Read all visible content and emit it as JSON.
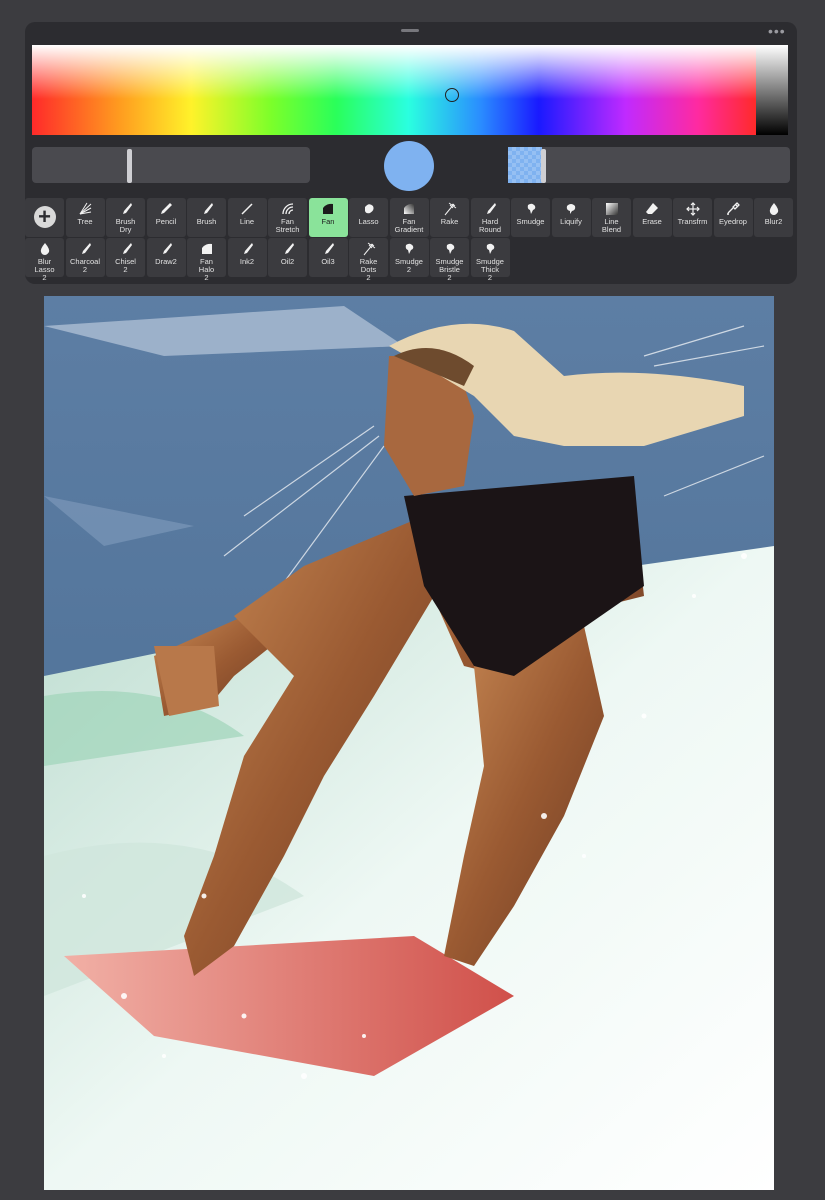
{
  "menu": {
    "more_glyph": "•••"
  },
  "color": {
    "current": "#7fb2f0",
    "spectrum_colors": [
      "#ff2a2a",
      "#ff9b1f",
      "#fff22a",
      "#2aff5a",
      "#2affe0",
      "#2a8cff",
      "#1a1aff",
      "#c02aff",
      "#ff2aa0"
    ],
    "opacity_fraction": 0.13
  },
  "tools": [
    {
      "label": "",
      "icon": "add-icon"
    },
    {
      "label": "Tree",
      "icon": "tree-brush-icon"
    },
    {
      "label": "Brush\nDry",
      "icon": "brush-icon"
    },
    {
      "label": "Pencil",
      "icon": "pencil-icon"
    },
    {
      "label": "Brush",
      "icon": "brush-icon"
    },
    {
      "label": "Line",
      "icon": "line-icon"
    },
    {
      "label": "Fan\nStretch",
      "icon": "fan-stretch-icon"
    },
    {
      "label": "Fan",
      "icon": "fan-icon",
      "active": true
    },
    {
      "label": "Lasso",
      "icon": "lasso-icon"
    },
    {
      "label": "Fan\nGradient",
      "icon": "fan-gradient-icon"
    },
    {
      "label": "Rake",
      "icon": "rake-icon"
    },
    {
      "label": "Hard\nRound",
      "icon": "brush-icon"
    },
    {
      "label": "Smudge",
      "icon": "smudge-icon"
    },
    {
      "label": "Liquify",
      "icon": "liquify-icon"
    },
    {
      "label": "Line\nBlend",
      "icon": "line-blend-icon"
    },
    {
      "label": "Erase",
      "icon": "eraser-icon"
    },
    {
      "label": "Transfrm",
      "icon": "transform-icon"
    },
    {
      "label": "Eyedrop",
      "icon": "eyedropper-icon"
    },
    {
      "label": "Blur2",
      "icon": "drop-icon"
    },
    {
      "label": "Blur\nLasso\n2",
      "icon": "drop-icon"
    },
    {
      "label": "Charcoal\n2",
      "icon": "brush-icon"
    },
    {
      "label": "Chisel\n2",
      "icon": "brush-icon"
    },
    {
      "label": "Draw2",
      "icon": "brush-icon"
    },
    {
      "label": "Fan\nHalo\n2",
      "icon": "fan-icon"
    },
    {
      "label": "Ink2",
      "icon": "brush-icon"
    },
    {
      "label": "Oil2",
      "icon": "brush-icon"
    },
    {
      "label": "Oil3",
      "icon": "brush-icon"
    },
    {
      "label": "Rake\nDots\n2",
      "icon": "rake-icon"
    },
    {
      "label": "Smudge\n2",
      "icon": "smudge-icon"
    },
    {
      "label": "Smudge\nBristle\n2",
      "icon": "smudge-icon"
    },
    {
      "label": "Smudge\nThick\n2",
      "icon": "smudge-icon"
    }
  ],
  "canvas": {
    "sky_color": "#4f6f94",
    "water_color": "#e6f2ee",
    "skin_color": "#b0703f",
    "hair_color": "#e8d6b2",
    "swimsuit_color": "#1b1416",
    "board_color": "#e07a76"
  }
}
